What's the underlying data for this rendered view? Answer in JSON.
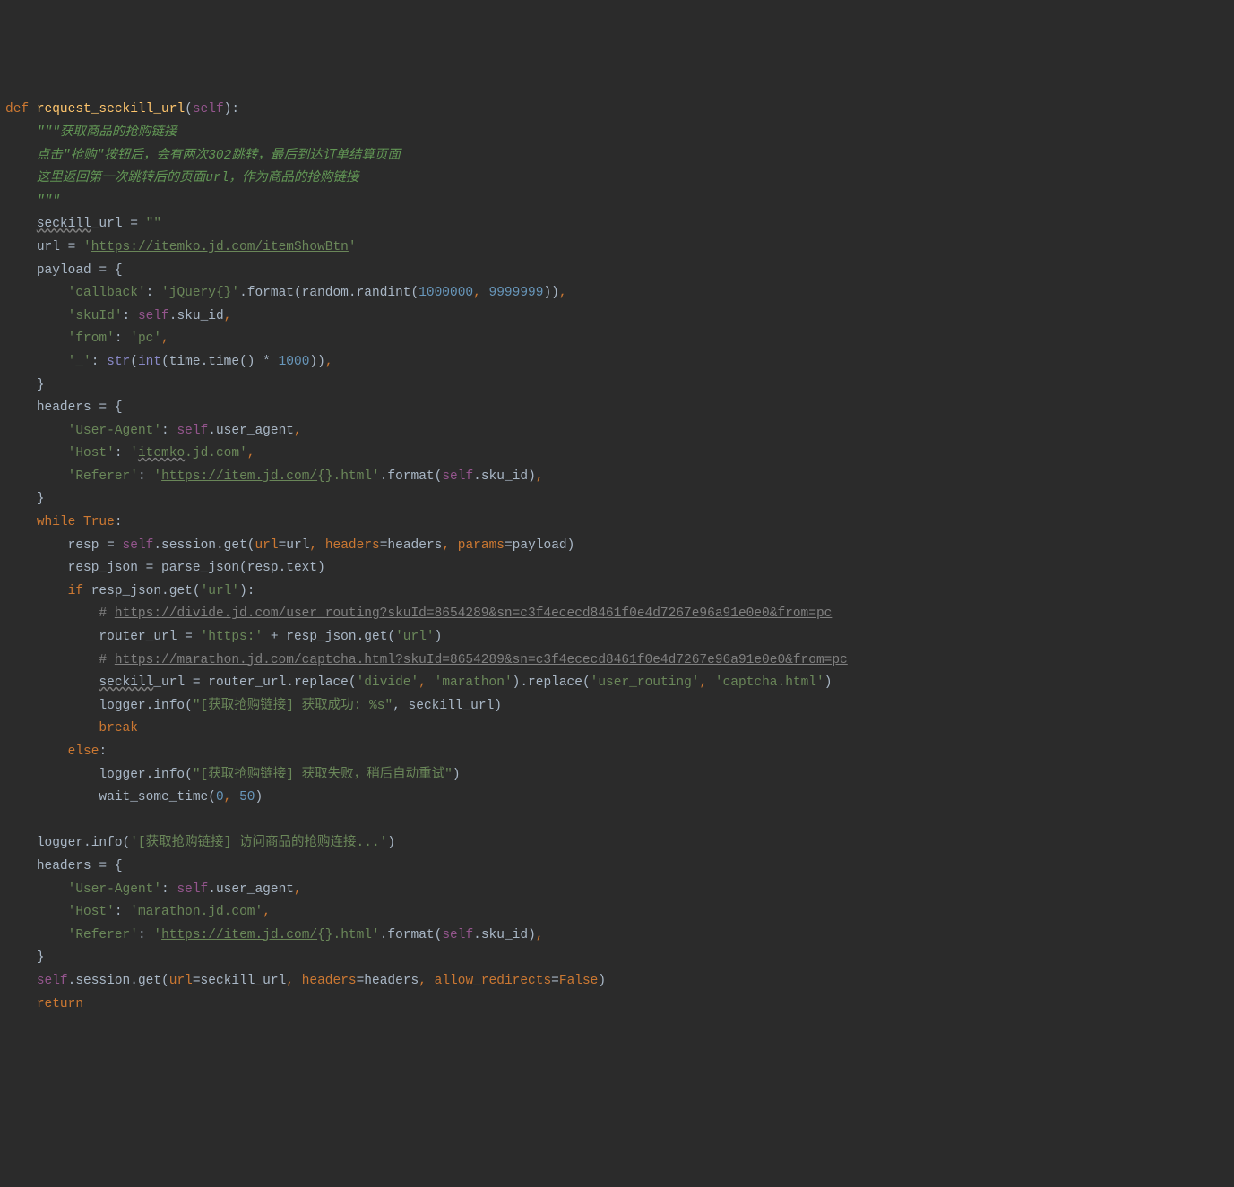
{
  "c": {
    "def": "def",
    "funcname": "request_seckill_url",
    "self": "self",
    "doc1": "\"\"\"获取商品的抢购链接",
    "doc2": "点击\"抢购\"按钮后，会有两次302跳转，最后到达订单结算页面",
    "doc3": "这里返回第一次跳转后的页面url，作为商品的抢购链接",
    "doc4": "\"\"\"",
    "seckill": "seckill",
    "url_suffix": "_url = ",
    "empty": "\"\"",
    "url_eq": "url = ",
    "q1": "'",
    "url1": "https://itemko.jd.com/itemShowBtn",
    "payload": "payload = {",
    "k_callback": "'callback'",
    "colon": ": ",
    "v_jquery": "'jQuery{}'",
    "dot_format": ".format(random.randint(",
    "n_1000000": "1000000",
    "comma_sp": ", ",
    "n_9999999": "9999999",
    "close2c": ")),",
    "k_skuId": "'skuId'",
    "dot_sku_id": ".sku_id",
    "comma": ",",
    "k_from": "'from'",
    "v_pc": "'pc'",
    "k_underscore": "'_'",
    "str_fn": "str",
    "int_fn": "int",
    "time_time": "(time.time() * ",
    "n_1000": "1000",
    "close3c": "))),",
    "close_brace": "}",
    "headers_eq": "headers = {",
    "k_ua": "'User-Agent'",
    "dot_ua": ".user_agent",
    "k_host": "'Host'",
    "v_itemko_q": "'",
    "v_itemko": "itemko",
    "v_itemko_tail": ".jd.com'",
    "k_referer": "'Referer'",
    "ref_q": "'",
    "ref_url": "https://item.jd.com/",
    "ref_tail": "{}.html'",
    "dot_format2": ".format(",
    "close1c": "),",
    "while": "while",
    "true": "True",
    "resp_eq": "resp = ",
    "dot_session_get": ".session.get(",
    "p_url": "url",
    "eq_url": "=url",
    "p_headers": "headers",
    "eq_headers": "=headers",
    "p_params": "params",
    "eq_payload": "=payload)",
    "resp_json_eq": "resp_json = parse_json(resp.text)",
    "if": "if",
    "resp_json_get": "resp_json.get(",
    "s_url": "'url'",
    "close_colon": "):",
    "hash": "# ",
    "cmt_url1": "https://divide.jd.com/user_routing?skuId=8654289&sn=c3f4ececd8461f0e4d7267e96a91e0e0&from=pc",
    "router_eq": "router_url = ",
    "s_https": "'https:'",
    "plus": " + resp_json.get(",
    "close1": ")",
    "cmt_url2": "https://marathon.jd.com/captcha.html?skuId=8654289&sn=c3f4ececd8461f0e4d7267e96a91e0e0&from=pc",
    "seckill_url_eq": "_url = router_url.replace(",
    "s_divide": "'divide'",
    "s_marathon": "'marathon'",
    "dot_replace": ").replace(",
    "s_user_routing": "'user_routing'",
    "s_captcha": "'captcha.html'",
    "logger_info": "logger.info(",
    "s_success": "\"[获取抢购链接] 获取成功: %s\"",
    "seckill_url_ref": ", seckill_url)",
    "break": "break",
    "else": "else",
    "s_fail": "\"[获取抢购链接] 获取失败，稍后自动重试\"",
    "wait": "wait_some_time(",
    "n_0": "0",
    "n_50": "50",
    "s_visit": "'[获取抢购链接] 访问商品的抢购连接...'",
    "v_marathon_host": "'marathon.jd.com'",
    "eq_seckill_url": "=seckill_url",
    "p_allow": "allow_redirects",
    "eq_false": "=",
    "false": "False",
    "return": "return"
  }
}
